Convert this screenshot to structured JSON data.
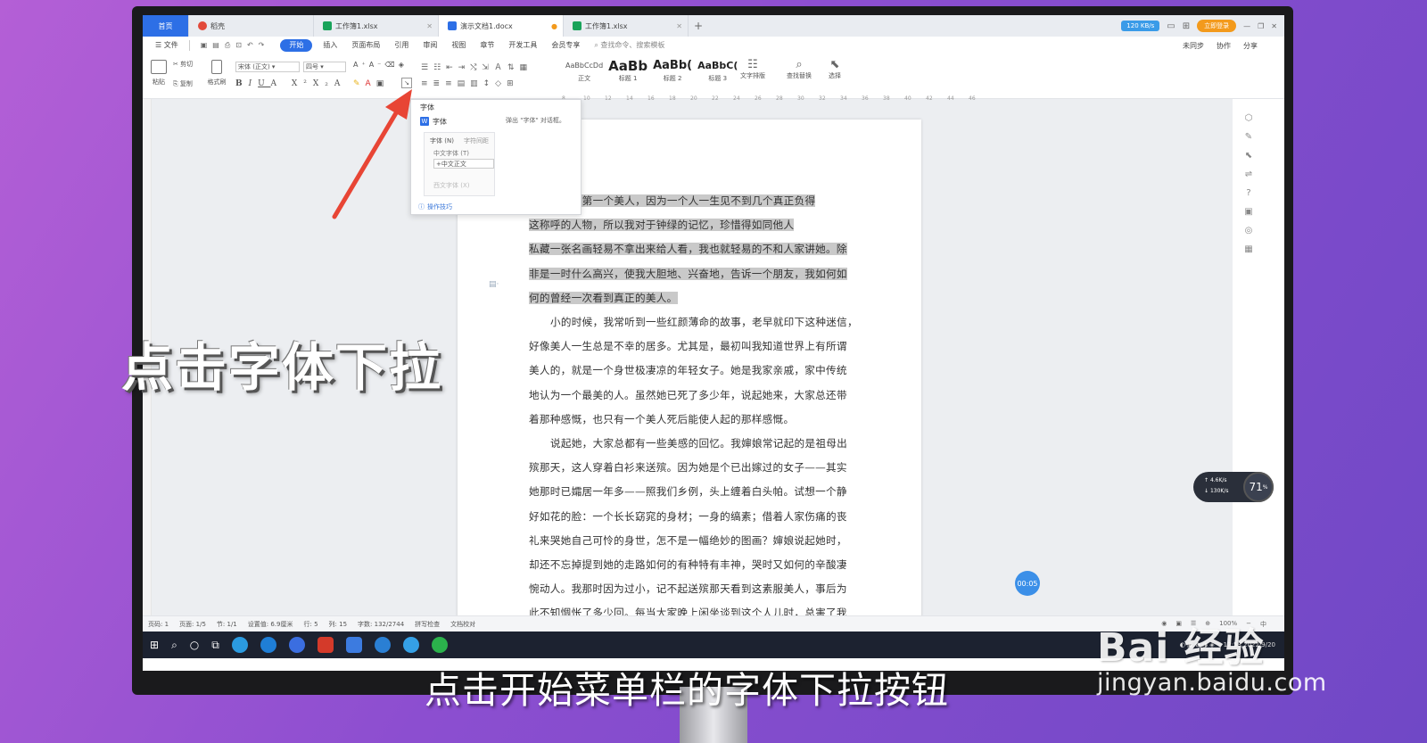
{
  "tabs": [
    {
      "label": "首页",
      "icon": "home-tab",
      "active": false
    },
    {
      "label": "稻壳",
      "icon": "docer-icon",
      "color": "#e24a3b"
    },
    {
      "label": "工作簿1.xlsx",
      "icon": "sheet-icon",
      "color": "#19a35a"
    },
    {
      "label": "演示文档1.docx",
      "icon": "doc-icon",
      "color": "#2d6fe6",
      "active": true
    },
    {
      "label": "工作簿1.xlsx",
      "icon": "sheet-icon",
      "color": "#19a35a"
    }
  ],
  "top_right": {
    "speed": "120 KB/s",
    "login": "立即登录"
  },
  "menu": [
    "文件",
    "开始",
    "插入",
    "页面布局",
    "引用",
    "审阅",
    "视图",
    "章节",
    "开发工具",
    "会员专享"
  ],
  "menu_search": "查找命令、搜索模板",
  "menu_right": [
    "未同步",
    "协作",
    "分享"
  ],
  "ribbon": {
    "paste": "粘贴",
    "cut": "剪切",
    "copy": "复制",
    "format_painter": "格式刷",
    "font_name": "宋体 (正文)",
    "font_size": "四号",
    "styles": [
      {
        "preview": "AaBbCcDd",
        "label": "正文"
      },
      {
        "preview": "AaBb",
        "label": "标题 1"
      },
      {
        "preview": "AaBb(",
        "label": "标题 2"
      },
      {
        "preview": "AaBbC(",
        "label": "标题 3"
      }
    ],
    "text_layout": "文字排版",
    "find_replace": "查找替换",
    "select": "选择"
  },
  "ruler_ticks": [
    "8",
    "10",
    "12",
    "14",
    "16",
    "18",
    "20",
    "22",
    "24",
    "26",
    "28",
    "30",
    "32",
    "34",
    "36",
    "38",
    "40",
    "42",
    "44",
    "46"
  ],
  "tooltip": {
    "title": "字体",
    "head": "字体",
    "description": "弹出 \"字体\" 对话框。",
    "tab1": "字体 (N)",
    "tab2": "字符间距",
    "cn_font_label": "中文字体 (T)",
    "cn_font_value": "+中文正文",
    "west_font_label": "西文字体 (X)",
    "tip": "操作技巧"
  },
  "document": {
    "p1_highlight": [
      "记忆中第一个美人，因为一个人一生见不到几个真正负得",
      "这称呼的人物，所以我对于钟绿的记忆，珍惜得如同他人",
      "私藏一张名画轻易不拿出来给人看，我也就轻易的不和人家讲她。除",
      "非是一时什么高兴，使我大胆地、兴奋地，告诉一个朋友，我如何如",
      "何的曾经一次看到真正的美人。"
    ],
    "p2": [
      "小的时候，我常听到一些红颜薄命的故事，老早就印下这种迷信，",
      "好像美人一生总是不幸的居多。尤其是，最初叫我知道世界上有所谓",
      "美人的，就是一个身世极凄凉的年轻女子。她是我家亲戚，家中传统",
      "地认为一个最美的人。虽然她已死了多少年，说起她来，大家总还带",
      "着那种感慨，也只有一个美人死后能使人起的那样感慨。"
    ],
    "p3": [
      "说起她，大家总都有一些美感的回忆。我婶娘常记起的是祖母出",
      "殡那天，这人穿着白衫来送殡。因为她是个已出嫁过的女子——其实",
      "她那时已孀居一年多——照我们乡例，头上缠着白头帕。试想一个静",
      "好如花的脸：一个长长窈窕的身材；一身的缟素；借着人家伤痛的丧",
      "礼来哭她自己可怜的身世，怎不是一幅绝妙的图画？婶娘说起她时，",
      "却还不忘掉提到她的走路如何的有种特有丰神，哭时又如何的辛酸凄",
      "惋动人。我那时因为过小，记不起送殡那天看到这素服美人，事后为",
      "此不知惆怅了多少回。每当大家晚上闲坐谈到这个人儿时，总害了我"
    ]
  },
  "status": [
    "页码: 1",
    "页面: 1/5",
    "节: 1/1",
    "设置值: 6.9厘米",
    "行: 5",
    "列: 15",
    "字数: 132/2744",
    "拼写检查",
    "文档校对"
  ],
  "status_right": {
    "zoom": "100%",
    "ime": "中"
  },
  "speed_widget": {
    "up": "4.6K/s",
    "down": "130K/s",
    "percent": "71"
  },
  "recording_timer": "00:05",
  "tray": {
    "time": "12:58",
    "date": "2022/9/20"
  },
  "overlay_text": "点击字体下拉",
  "subtitle": "点击开始菜单栏的字体下拉按钮",
  "watermark": {
    "brand": "Bai 经验",
    "url": "jingyan.baidu.com"
  },
  "colors": {
    "accent": "#2d6fe6",
    "arrow": "#e84535",
    "selection": "#c9c9c9"
  }
}
